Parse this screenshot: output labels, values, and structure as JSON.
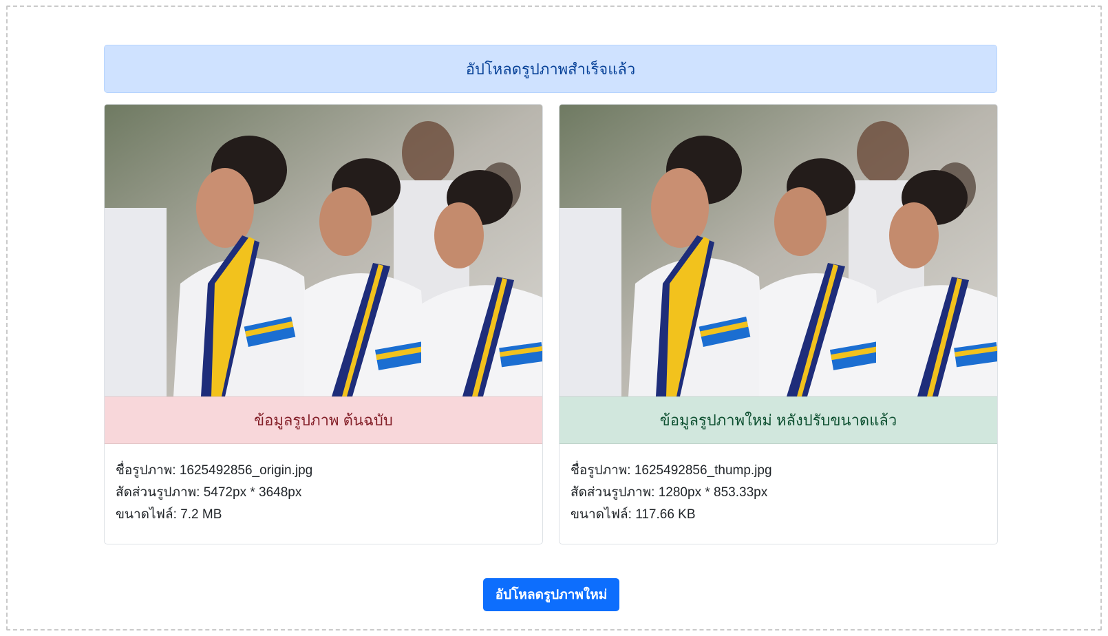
{
  "alert": {
    "message": "อัปโหลดรูปภาพสำเร็จแล้ว"
  },
  "original": {
    "header": "ข้อมูลรูปภาพ ต้นฉบับ",
    "name_label": "ชื่อรูปภาพ:",
    "name_value": "1625492856_origin.jpg",
    "ratio_label": "สัดส่วนรูปภาพ:",
    "ratio_value": "5472px * 3648px",
    "size_label": "ขนาดไฟล์:",
    "size_value": "7.2 MB"
  },
  "resized": {
    "header": "ข้อมูลรูปภาพใหม่ หลังปรับขนาดแล้ว",
    "name_label": "ชื่อรูปภาพ:",
    "name_value": "1625492856_thump.jpg",
    "ratio_label": "สัดส่วนรูปภาพ:",
    "ratio_value": "1280px * 853.33px",
    "size_label": "ขนาดไฟล์:",
    "size_value": "117.66 KB"
  },
  "upload_button": {
    "label": "อัปโหลดรูปภาพใหม่"
  },
  "colors": {
    "alert_bg": "#cfe2ff",
    "alert_text": "#084298",
    "danger_bg": "#f8d7da",
    "danger_text": "#842029",
    "success_bg": "#d1e7dd",
    "success_text": "#0f5132",
    "primary": "#0d6efd"
  }
}
